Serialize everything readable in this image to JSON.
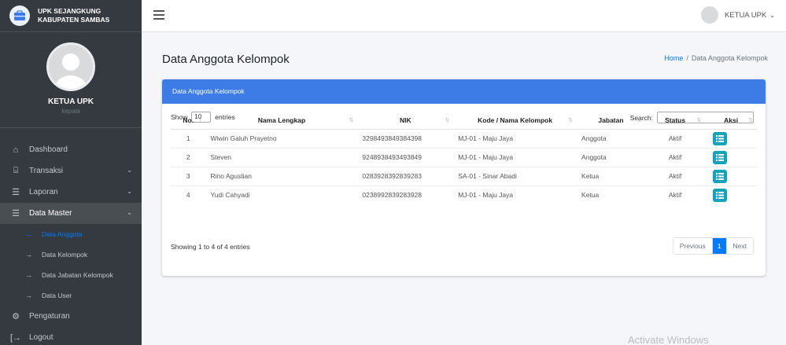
{
  "brand": {
    "line1": "UPK SEJANGKUNG",
    "line2": "KABUPATEN SAMBAS"
  },
  "user_panel": {
    "name": "KETUA UPK",
    "role": "kepala"
  },
  "topbar": {
    "user_label": "KETUA UPK"
  },
  "sidebar": {
    "items": [
      {
        "label": "Dashboard",
        "icon": "home-icon"
      },
      {
        "label": "Transaksi",
        "icon": "bank-icon"
      },
      {
        "label": "Laporan",
        "icon": "list-icon"
      },
      {
        "label": "Data Master",
        "icon": "list-icon"
      }
    ],
    "sub_items": [
      {
        "label": "Data Anggota"
      },
      {
        "label": "Data Kelompok"
      },
      {
        "label": "Data Jabatan Kelompok"
      },
      {
        "label": "Data User"
      }
    ],
    "bottom_items": [
      {
        "label": "Pengaturan",
        "icon": "gear-icon"
      },
      {
        "label": "Logout",
        "icon": "logout-icon"
      }
    ]
  },
  "page": {
    "title": "Data Anggota Kelompok",
    "breadcrumb_home": "Home",
    "breadcrumb_sep": "/",
    "breadcrumb_current": "Data Anggota Kelompok"
  },
  "card": {
    "header": "Data Anggota Kelompok",
    "show_label": "Show",
    "show_value": "10",
    "entries_label": "entries",
    "search_label": "Search:"
  },
  "table": {
    "columns": [
      "No.",
      "Nama Lengkap",
      "NIK",
      "Kode / Nama Kelompok",
      "Jabatan",
      "Status",
      "Aksi"
    ],
    "rows": [
      [
        "1",
        "Wiwin Galuh Prayetno",
        "3298493849384398",
        "MJ-01 - Maju Jaya",
        "Anggota",
        "Aktif"
      ],
      [
        "2",
        "Steven",
        "9248938493493849",
        "MJ-01 - Maju Jaya",
        "Anggota",
        "Aktif"
      ],
      [
        "3",
        "Rino Agustian",
        "0283928392839283",
        "SA-01 - Sinar Abadi",
        "Ketua",
        "Aktif"
      ],
      [
        "4",
        "Yudi Cahyadi",
        "0238992839283928",
        "MJ-01 - Maju Jaya",
        "Ketua",
        "Aktif"
      ]
    ]
  },
  "footer": {
    "info": "Showing 1 to 4 of 4 entries",
    "prev": "Previous",
    "page": "1",
    "next": "Next"
  },
  "watermark": "Activate Windows",
  "colors": {
    "sidebar_bg": "#343a40",
    "card_header": "#3d7ce6",
    "aksi_button": "#17a2b8",
    "link": "#007bff"
  }
}
